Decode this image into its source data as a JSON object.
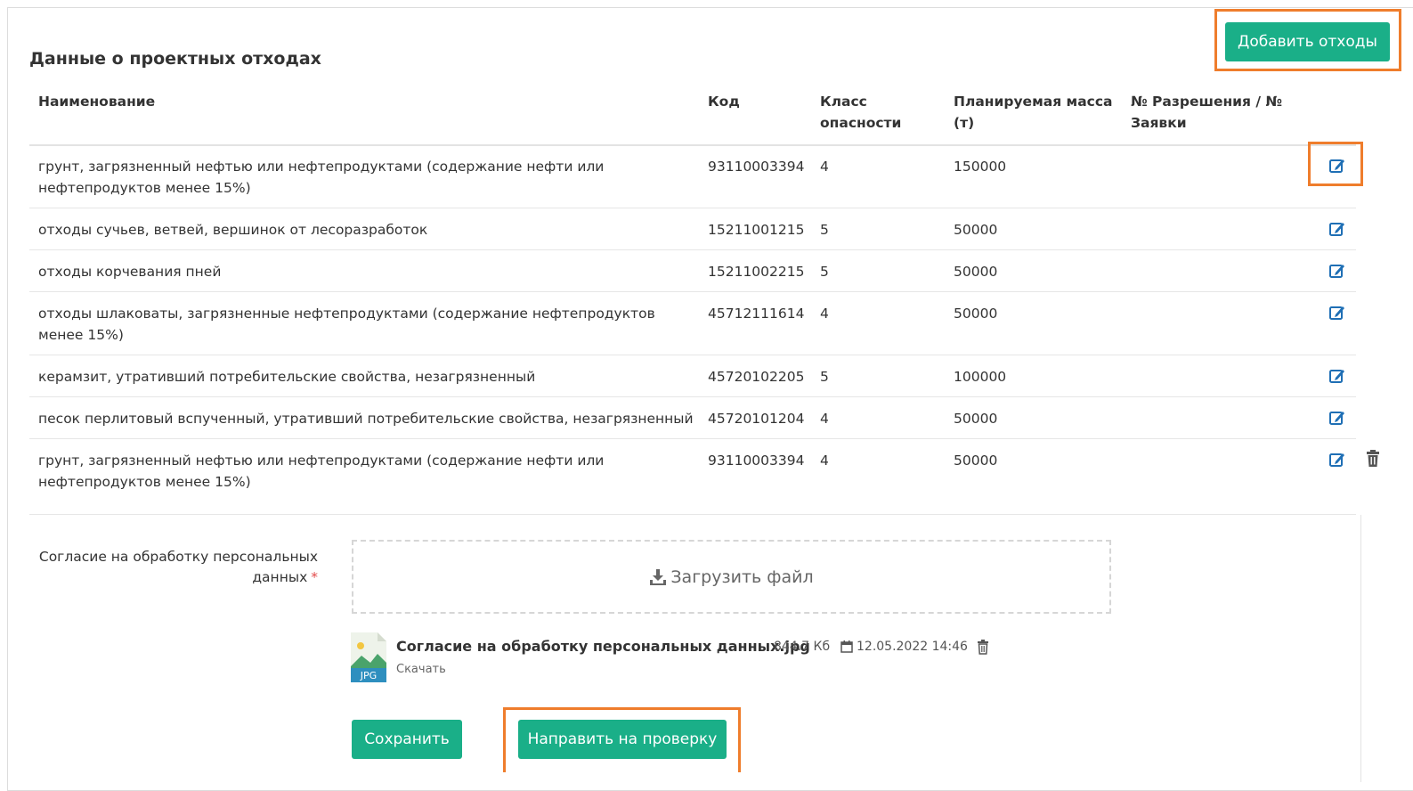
{
  "section_title": "Данные о проектных отходах",
  "add_button_label": "Добавить отходы",
  "table": {
    "headers": {
      "name": "Наименование",
      "code": "Код",
      "class_line1": "Класс",
      "class_line2": "опасности",
      "mass_line1": "Планируемая масса",
      "mass_line2": "(т)",
      "permit_line1": "№ Разрешения / №",
      "permit_line2": "Заявки"
    },
    "rows": [
      {
        "name": "грунт, загрязненный нефтью или нефтепродуктами (содержание нефти или нефтепродуктов менее 15%)",
        "code": "93110003394",
        "class": "4",
        "mass": "150000",
        "permit": ""
      },
      {
        "name": "отходы сучьев, ветвей, вершинок от лесоразработок",
        "code": "15211001215",
        "class": "5",
        "mass": "50000",
        "permit": ""
      },
      {
        "name": "отходы корчевания пней",
        "code": "15211002215",
        "class": "5",
        "mass": "50000",
        "permit": ""
      },
      {
        "name": "отходы шлаковаты, загрязненные нефтепродуктами (содержание нефтепродуктов менее 15%)",
        "code": "45712111614",
        "class": "4",
        "mass": "50000",
        "permit": ""
      },
      {
        "name": "керамзит, утративший потребительские свойства, незагрязненный",
        "code": "45720102205",
        "class": "5",
        "mass": "100000",
        "permit": ""
      },
      {
        "name": "песок перлитовый вспученный, утративший потребительские свойства, незагрязненный",
        "code": "45720101204",
        "class": "4",
        "mass": "50000",
        "permit": ""
      },
      {
        "name": "грунт, загрязненный нефтью или нефтепродуктами (содержание нефти или нефтепродуктов менее 15%)",
        "code": "93110003394",
        "class": "4",
        "mass": "50000",
        "permit": ""
      }
    ]
  },
  "consent": {
    "label_line1": "Согласие на обработку персональных",
    "label_line2": "данных",
    "required_mark": "*",
    "upload_label": "Загрузить файл",
    "file": {
      "type_badge": "JPG",
      "name": "Согласие на обработку персональных данных.jpg",
      "size": "844.7 Кб",
      "date": "12.05.2022 14:46",
      "download_label": "Скачать"
    }
  },
  "buttons": {
    "save": "Сохранить",
    "submit": "Направить на проверку"
  },
  "colors": {
    "accent": "#1aaf88",
    "highlight": "#ef7d2c",
    "edit_icon": "#1f6fb5"
  }
}
